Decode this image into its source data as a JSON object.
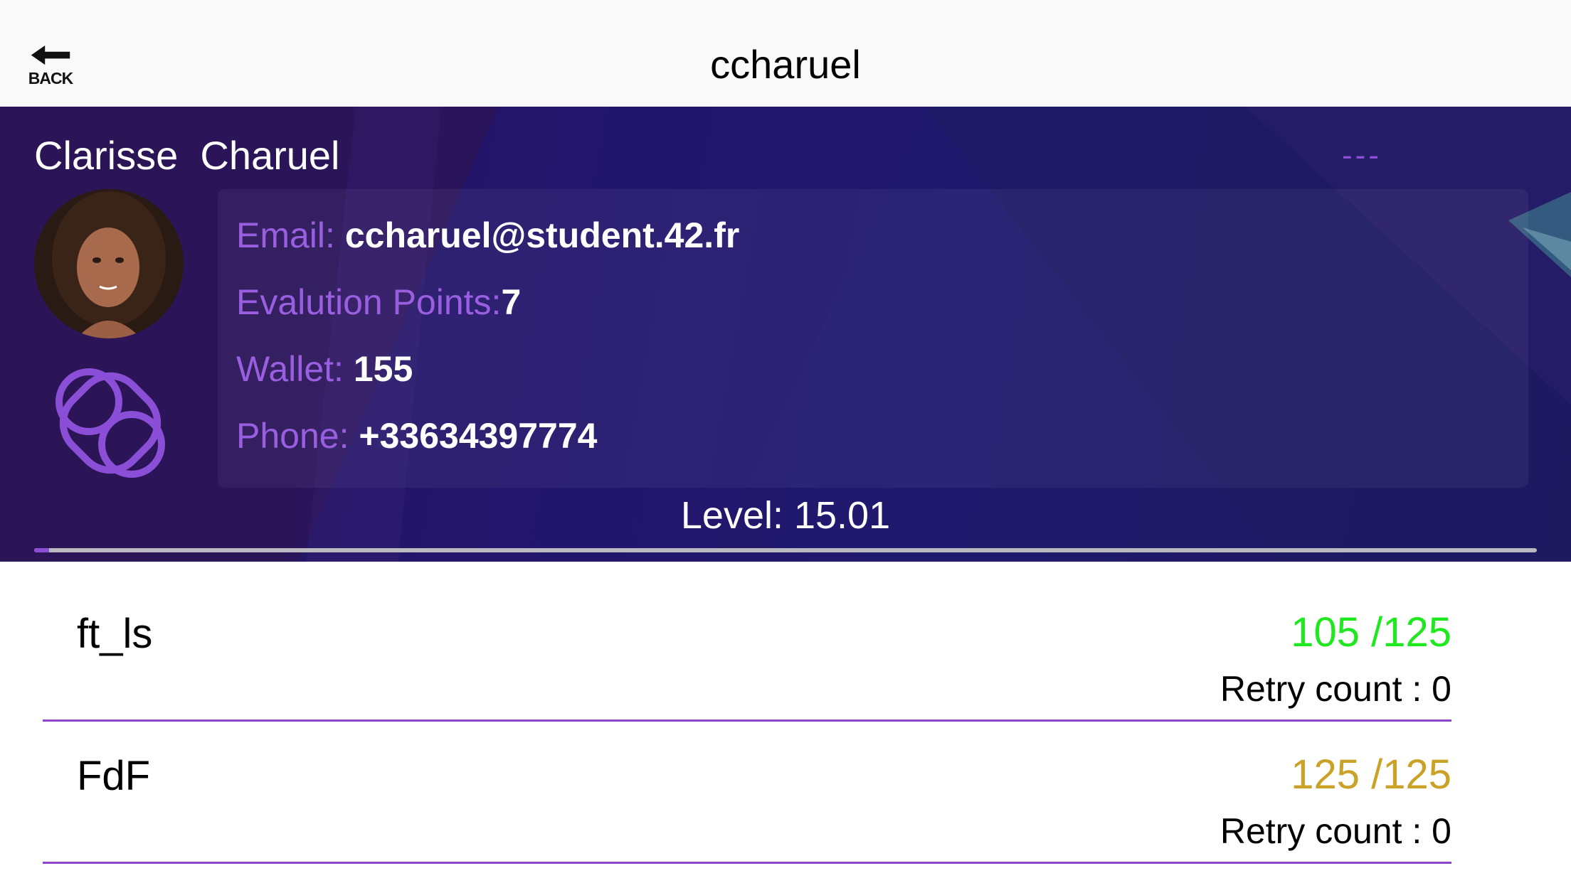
{
  "navbar": {
    "back_label": "BACK",
    "title": "ccharuel"
  },
  "profile": {
    "full_name": "Clarisse  Charuel",
    "dashes": "---",
    "email_label": "Email:",
    "email_value": "ccharuel@student.42.fr",
    "eval_label": "Evalution Points:",
    "eval_value": "7",
    "wallet_label": "Wallet:",
    "wallet_value": "155",
    "phone_label": "Phone:",
    "phone_value": "+33634397774",
    "level_text": "Level: 15.01",
    "level_progress": 0.01
  },
  "projects": [
    {
      "name": "ft_ls",
      "score": "105 /125",
      "score_color": "#1fe81f",
      "retry": "Retry count : 0"
    },
    {
      "name": "FdF",
      "score": "125 /125",
      "score_color": "#c9a227",
      "retry": "Retry count : 0"
    }
  ],
  "colors": {
    "accent": "#8a4fd6",
    "divider": "#8e44c9",
    "label": "#9a5fe0"
  },
  "icons": {
    "back": "arrow-left-icon",
    "coalition": "coalition-knot-icon"
  }
}
